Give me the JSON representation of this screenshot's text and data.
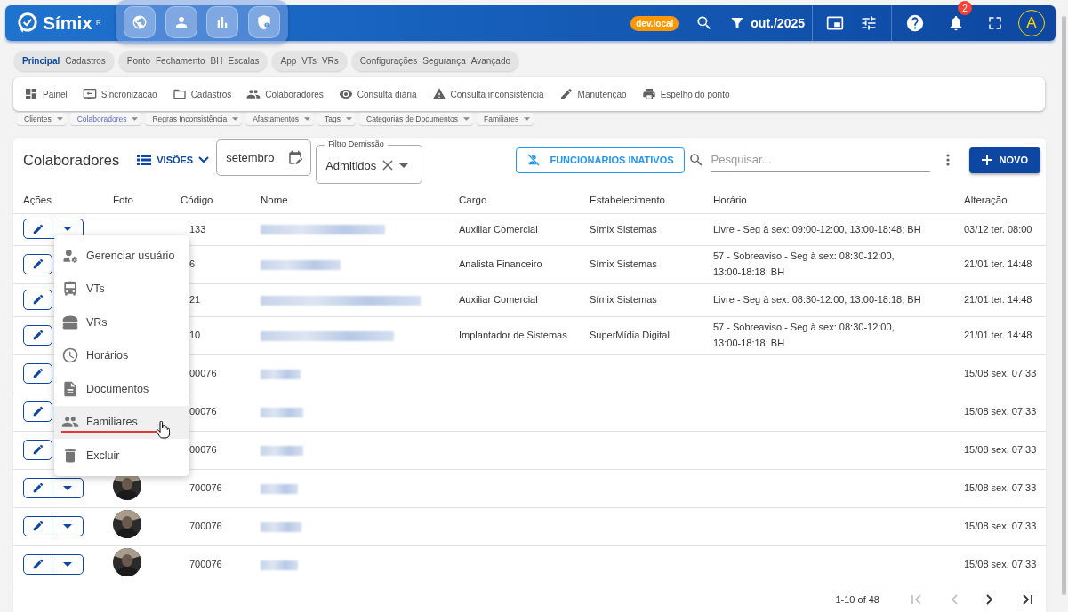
{
  "top_bar": {
    "logo": "Símix",
    "logo_mark": "R",
    "env_badge": "dev.local",
    "period": "out./2025",
    "notifications": "2",
    "avatar": "A"
  },
  "module_groups": [
    {
      "items": [
        {
          "label": "Principal",
          "selected": true
        },
        {
          "label": "Cadastros",
          "selected": false
        }
      ]
    },
    {
      "items": [
        {
          "label": "Ponto",
          "selected": false
        },
        {
          "label": "Fechamento",
          "selected": false
        },
        {
          "label": "BH",
          "selected": false
        },
        {
          "label": "Escalas",
          "selected": false
        }
      ]
    },
    {
      "items": [
        {
          "label": "App",
          "selected": false
        },
        {
          "label": "VTs",
          "selected": false
        },
        {
          "label": "VRs",
          "selected": false
        }
      ]
    },
    {
      "items": [
        {
          "label": "Configurações",
          "selected": false
        },
        {
          "label": "Segurança",
          "selected": false
        },
        {
          "label": "Avançado",
          "selected": false
        }
      ]
    }
  ],
  "menu": [
    {
      "label": "Painel",
      "kind": "dashboard"
    },
    {
      "label": "Sincronizacao",
      "kind": "sync"
    },
    {
      "label": "Cadastros",
      "kind": "folder"
    },
    {
      "label": "Colaboradores",
      "kind": "people"
    },
    {
      "label": "Consulta diária",
      "kind": "eye"
    },
    {
      "label": "Consulta inconsistência",
      "kind": "warning"
    },
    {
      "label": "Manutenção",
      "kind": "pencil"
    },
    {
      "label": "Espelho do ponto",
      "kind": "printer"
    }
  ],
  "submenu": [
    {
      "label": "Clientes",
      "selected": false
    },
    {
      "label": "Colaboradores",
      "selected": true
    },
    {
      "label": "Regras Inconsistência",
      "selected": false
    },
    {
      "label": "Afastamentos",
      "selected": false
    },
    {
      "label": "Tags",
      "selected": false
    },
    {
      "label": "Categorias de Documentos",
      "selected": false
    },
    {
      "label": "Familiares",
      "selected": false
    }
  ],
  "page": {
    "title": "Colaboradores",
    "views_button": "VISÕES",
    "month_field": {
      "value": "setembro"
    },
    "filter": {
      "label": "Filtro Demissão",
      "value": "Admitidos"
    },
    "inactive_button": "FUNCIONÁRIOS INATIVOS",
    "search": {
      "placeholder": "Pesquisar..."
    },
    "new_button": "NOVO"
  },
  "table": {
    "columns": [
      "Ações",
      "Foto",
      "Código",
      "Nome",
      "Cargo",
      "Estabelecimento",
      "Horário",
      "Alteração"
    ],
    "rows": [
      {
        "code": "133",
        "cargo": "Auxiliar Comercial",
        "estabelecimento": "Símix Sistemas",
        "horario": "Livre - Seg à sex: 09:00-12:00, 13:00-18:48; BH",
        "alteracao": "03/12 ter. 08:00",
        "photo": false,
        "dropdown": true
      },
      {
        "code": "6",
        "cargo": "Analista Financeiro",
        "estabelecimento": "Símix Sistemas",
        "horario": "57 - Sobreaviso - Seg à sex: 08:30-12:00, 13:00-18:18; BH",
        "alteracao": "21/01 ter. 14:48",
        "photo": false,
        "dropdown": false
      },
      {
        "code": "21",
        "cargo": "Auxiliar Comercial",
        "estabelecimento": "Símix Sistemas",
        "horario": "Livre - Seg à sex: 08:30-12:00, 13:00-18:18; BH",
        "alteracao": "21/01 ter. 14:48",
        "photo": false,
        "dropdown": false
      },
      {
        "code": "10",
        "cargo": "Implantador de Sistemas",
        "estabelecimento": "SuperMídia Digital",
        "horario": "57 - Sobreaviso - Seg à sex: 08:30-12:00, 13:00-18:18; BH",
        "alteracao": "21/01 ter. 14:48",
        "photo": false,
        "dropdown": false
      },
      {
        "code": "00076",
        "cargo": "",
        "estabelecimento": "",
        "horario": "",
        "alteracao": "15/08 sex. 07:33",
        "photo": false,
        "dropdown": false
      },
      {
        "code": "00076",
        "cargo": "",
        "estabelecimento": "",
        "horario": "",
        "alteracao": "15/08 sex. 07:33",
        "photo": false,
        "dropdown": false
      },
      {
        "code": "00076",
        "cargo": "",
        "estabelecimento": "",
        "horario": "",
        "alteracao": "15/08 sex. 07:33",
        "photo": false,
        "dropdown": false
      },
      {
        "code": "700076",
        "cargo": "",
        "estabelecimento": "",
        "horario": "",
        "alteracao": "15/08 sex. 07:33",
        "photo": true,
        "dropdown": true
      },
      {
        "code": "700076",
        "cargo": "",
        "estabelecimento": "",
        "horario": "",
        "alteracao": "15/08 sex. 07:33",
        "photo": true,
        "dropdown": true
      },
      {
        "code": "700076",
        "cargo": "",
        "estabelecimento": "",
        "horario": "",
        "alteracao": "15/08 sex. 07:33",
        "photo": true,
        "dropdown": true
      }
    ]
  },
  "context_menu": [
    {
      "label": "Gerenciar usuário",
      "kind": "user-gear",
      "selected": false
    },
    {
      "label": "VTs",
      "kind": "bus",
      "selected": false
    },
    {
      "label": "VRs",
      "kind": "burger",
      "selected": false
    },
    {
      "label": "Horários",
      "kind": "clock",
      "selected": false
    },
    {
      "label": "Documentos",
      "kind": "document",
      "selected": false
    },
    {
      "label": "Familiares",
      "kind": "people",
      "selected": true
    },
    {
      "label": "Excluir",
      "kind": "trash",
      "selected": false
    }
  ],
  "pagination": {
    "range": "1-10 of 48"
  }
}
